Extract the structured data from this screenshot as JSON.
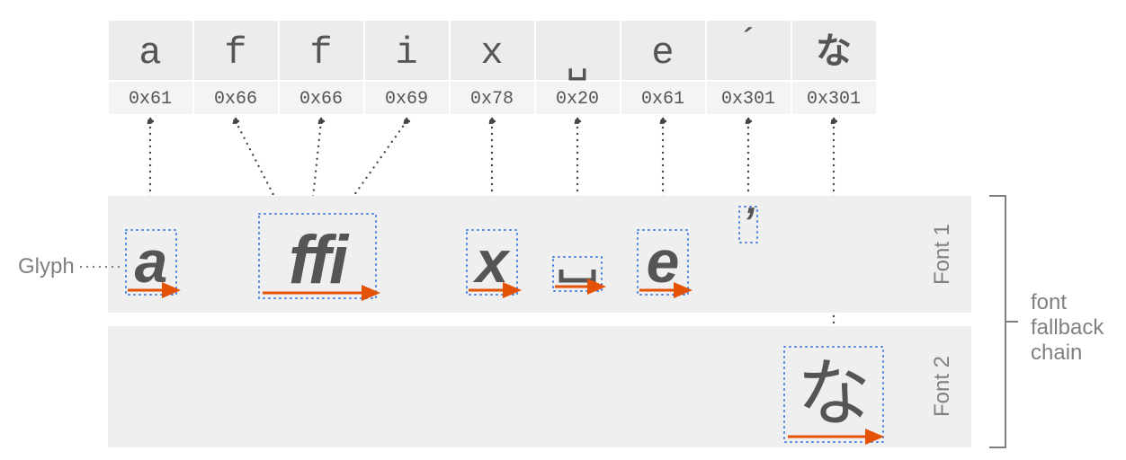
{
  "codepoints": {
    "row": [
      {
        "char": "a",
        "hex": "0x61"
      },
      {
        "char": "f",
        "hex": "0x66"
      },
      {
        "char": "f",
        "hex": "0x66"
      },
      {
        "char": "i",
        "hex": "0x69"
      },
      {
        "char": "x",
        "hex": "0x78"
      },
      {
        "char": "␣",
        "hex": "0x20"
      },
      {
        "char": "e",
        "hex": "0x61"
      },
      {
        "char": "´",
        "hex": "0x301"
      },
      {
        "char": "な",
        "hex": "0x301"
      }
    ]
  },
  "fonts": {
    "font1": {
      "label": "Font 1"
    },
    "font2": {
      "label": "Font 2"
    }
  },
  "legend": {
    "glyph": "Glyph",
    "fallback": [
      "font",
      "fallback",
      "chain"
    ]
  },
  "glyphs": {
    "font1": {
      "a": "a",
      "ffi": "ffi",
      "x": "x",
      "space": "␣",
      "e": "e",
      "accent": "ʼ"
    },
    "font2": {
      "na": "な"
    }
  }
}
